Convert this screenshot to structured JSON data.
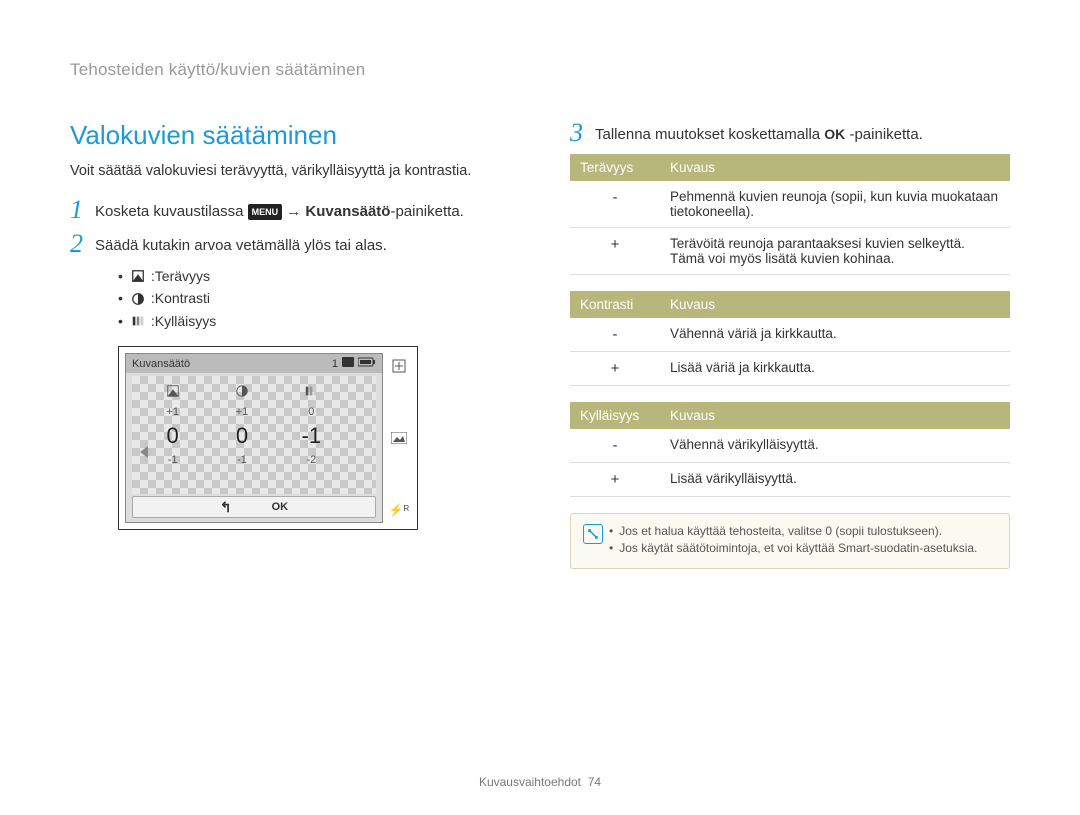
{
  "breadcrumb": "Tehosteiden käyttö/kuvien säätäminen",
  "title": "Valokuvien säätäminen",
  "intro": "Voit säätää valokuviesi terävyyttä, värikylläisyyttä ja kontrastia.",
  "steps": {
    "s1": {
      "num": "1",
      "pre": "Kosketa kuvaustilassa ",
      "menu": "MENU",
      "arrow": " → ",
      "bold": "Kuvansäätö",
      "post": "-painiketta."
    },
    "s2": {
      "num": "2",
      "text": "Säädä kutakin arvoa vetämällä ylös tai alas."
    },
    "s3": {
      "num": "3",
      "pre": "Tallenna muutokset koskettamalla ",
      "ok": "OK",
      "post": " -painiketta."
    }
  },
  "sublist": {
    "a": "Terävyys",
    "b": "Kontrasti",
    "c": "Kylläisyys"
  },
  "device": {
    "title": "Kuvansäätö",
    "header_num": "1",
    "row_small_top": {
      "a": "+1",
      "b": "+1",
      "c": "0"
    },
    "row_big": {
      "a": "0",
      "b": "0",
      "c": "-1"
    },
    "row_small_bot": {
      "a": "-1",
      "b": "-1",
      "c": "-2"
    },
    "back": "↰",
    "ok": "OK",
    "flash": "⚡ᴿ"
  },
  "tables": {
    "t1": {
      "h1": "Terävyys",
      "h2": "Kuvaus",
      "rows": [
        {
          "sym": "-",
          "desc": "Pehmennä kuvien reunoja (sopii, kun kuvia muokataan tietokoneella)."
        },
        {
          "sym": "+",
          "desc": "Terävöitä reunoja parantaaksesi kuvien selkeyttä. Tämä voi myös lisätä kuvien kohinaa."
        }
      ]
    },
    "t2": {
      "h1": "Kontrasti",
      "h2": "Kuvaus",
      "rows": [
        {
          "sym": "-",
          "desc": "Vähennä väriä ja kirkkautta."
        },
        {
          "sym": "+",
          "desc": "Lisää väriä ja kirkkautta."
        }
      ]
    },
    "t3": {
      "h1": "Kylläisyys",
      "h2": "Kuvaus",
      "rows": [
        {
          "sym": "-",
          "desc": "Vähennä värikylläisyyttä."
        },
        {
          "sym": "+",
          "desc": "Lisää värikylläisyyttä."
        }
      ]
    }
  },
  "notes": {
    "a": "Jos et halua käyttää tehosteita, valitse 0 (sopii tulostukseen).",
    "b": "Jos käytät säätötoimintoja, et voi käyttää Smart-suodatin-asetuksia."
  },
  "footer": {
    "section": "Kuvausvaihtoehdot",
    "page": "74"
  }
}
